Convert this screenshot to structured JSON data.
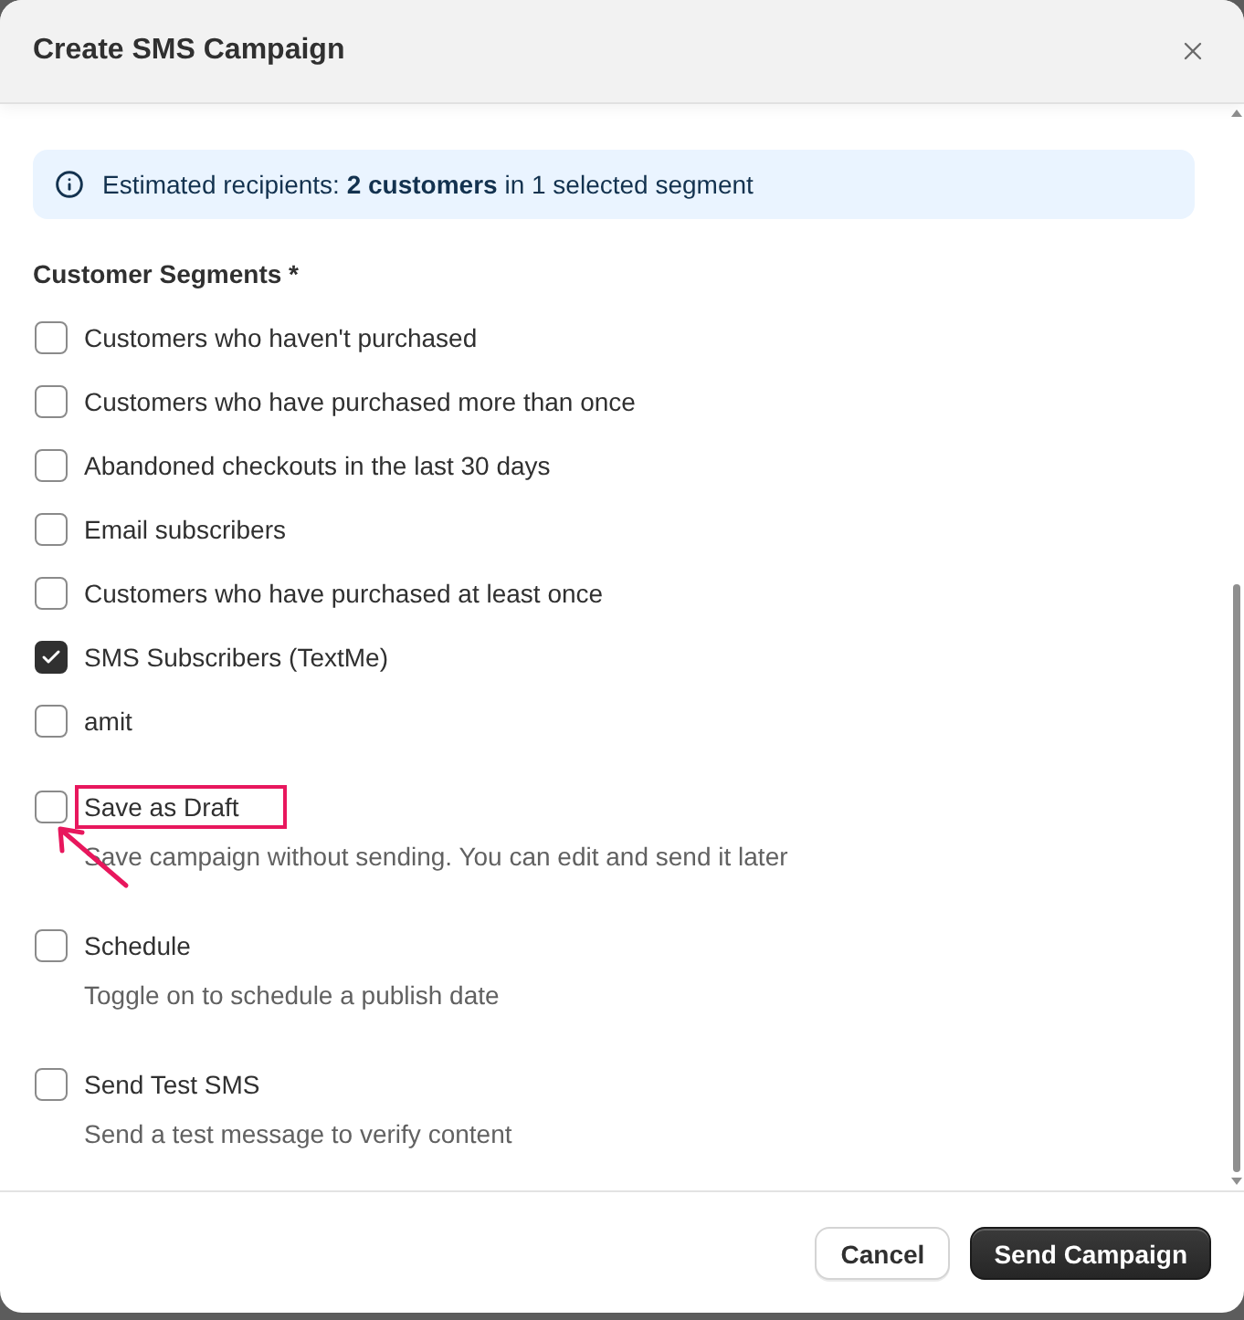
{
  "dialog": {
    "title": "Create SMS Campaign"
  },
  "banner": {
    "text": "Estimated recipients: **2 customers** in 1 selected segment"
  },
  "segments": {
    "label": "Customer Segments *",
    "items": [
      {
        "label": "Customers who haven't purchased",
        "checked": false
      },
      {
        "label": "Customers who have purchased more than once",
        "checked": false
      },
      {
        "label": "Abandoned checkouts in the last 30 days",
        "checked": false
      },
      {
        "label": "Email subscribers",
        "checked": false
      },
      {
        "label": "Customers who have purchased at least once",
        "checked": false
      },
      {
        "label": "SMS Subscribers (TextMe)",
        "checked": true
      },
      {
        "label": "amit",
        "checked": false
      }
    ]
  },
  "options": [
    {
      "label": "Save as Draft",
      "description": "Save campaign without sending. You can edit and send it later",
      "checked": false,
      "highlighted": true
    },
    {
      "label": "Schedule",
      "description": "Toggle on to schedule a publish date",
      "checked": false,
      "highlighted": false
    },
    {
      "label": "Send Test SMS",
      "description": "Send a test message to verify content",
      "checked": false,
      "highlighted": false
    }
  ],
  "buttons": [
    {
      "label": "Cancel",
      "kind": "secondary"
    },
    {
      "label": "Send Campaign",
      "kind": "primary"
    }
  ]
}
